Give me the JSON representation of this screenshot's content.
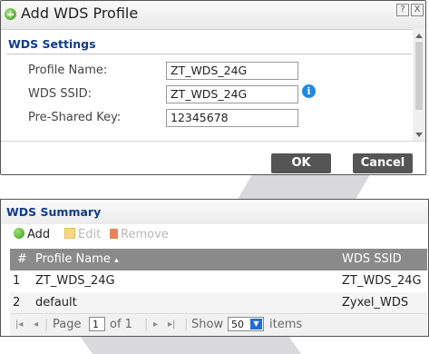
{
  "dialog": {
    "title": "Add WDS Profile",
    "help_icon": "?",
    "close_icon": "X",
    "section_title": "WDS Settings",
    "fields": [
      {
        "label": "Profile Name:",
        "value": "ZT_WDS_24G"
      },
      {
        "label": "WDS SSID:",
        "value": "ZT_WDS_24G"
      },
      {
        "label": "Pre-Shared Key:",
        "value": "12345678"
      }
    ],
    "info_icon": "i",
    "ok_label": "OK",
    "cancel_label": "Cancel"
  },
  "summary": {
    "title": "WDS Summary",
    "toolbar": {
      "add": "Add",
      "edit": "Edit",
      "remove": "Remove"
    },
    "columns": {
      "index": "#",
      "profile": "Profile Name",
      "sort_icon": "▴",
      "ssid": "WDS SSID"
    },
    "rows": [
      {
        "index": "1",
        "profile": "ZT_WDS_24G",
        "ssid": "ZT_WDS_24G"
      },
      {
        "index": "2",
        "profile": "default",
        "ssid": "Zyxel_WDS"
      }
    ],
    "pager": {
      "first": "|◂",
      "prev": "◂",
      "page_label": "Page",
      "page_value": "1",
      "of_label": "of 1",
      "next": "▸",
      "last": "▸|",
      "show_label": "Show",
      "show_value": "50",
      "items_label": "items"
    }
  },
  "colors": {
    "title_blue": "#0f3c8f",
    "button_gray": "#555555",
    "header_gray": "#8a8a8a",
    "info_blue": "#1e88e5"
  }
}
